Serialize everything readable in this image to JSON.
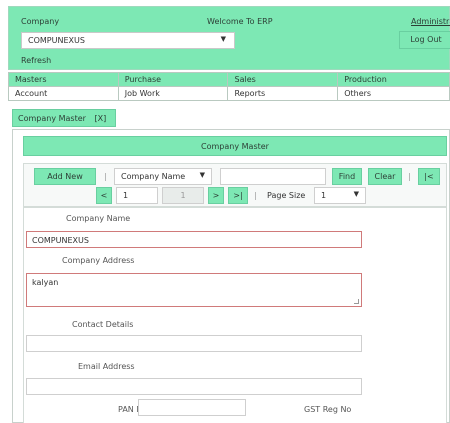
{
  "header": {
    "company_label": "Company",
    "welcome": "Welcome To ERP",
    "admin_link": "Administrat",
    "company_select": "COMPUNEXUS",
    "logout": "Log Out",
    "refresh": "Refresh"
  },
  "menu": {
    "top": [
      "Masters",
      "Purchase",
      "Sales",
      "Production"
    ],
    "bottom": [
      "Account",
      "Job Work",
      "Reports",
      "Others"
    ]
  },
  "tab": {
    "label": "Company Master",
    "close": "[X]"
  },
  "panel": {
    "title": "Company Master"
  },
  "toolbar": {
    "add_new": "Add New",
    "separator": "|",
    "search_field": "Company Name",
    "find": "Find",
    "clear": "Clear",
    "first": "|<",
    "prev": "<",
    "page_input": "1",
    "page_total": "1",
    "next": ">",
    "last": ">|",
    "page_size_label": "Page Size",
    "page_size_value": "1"
  },
  "form": {
    "company_name_label": "Company Name",
    "company_name_value": "COMPUNEXUS",
    "company_address_label": "Company Address",
    "company_address_value": "kalyan",
    "contact_details_label": "Contact Details",
    "contact_details_value": "",
    "email_label": "Email Address",
    "email_value": "",
    "pan_label": "PAN No",
    "pan_value": "",
    "gst_label": "GST Reg No"
  }
}
